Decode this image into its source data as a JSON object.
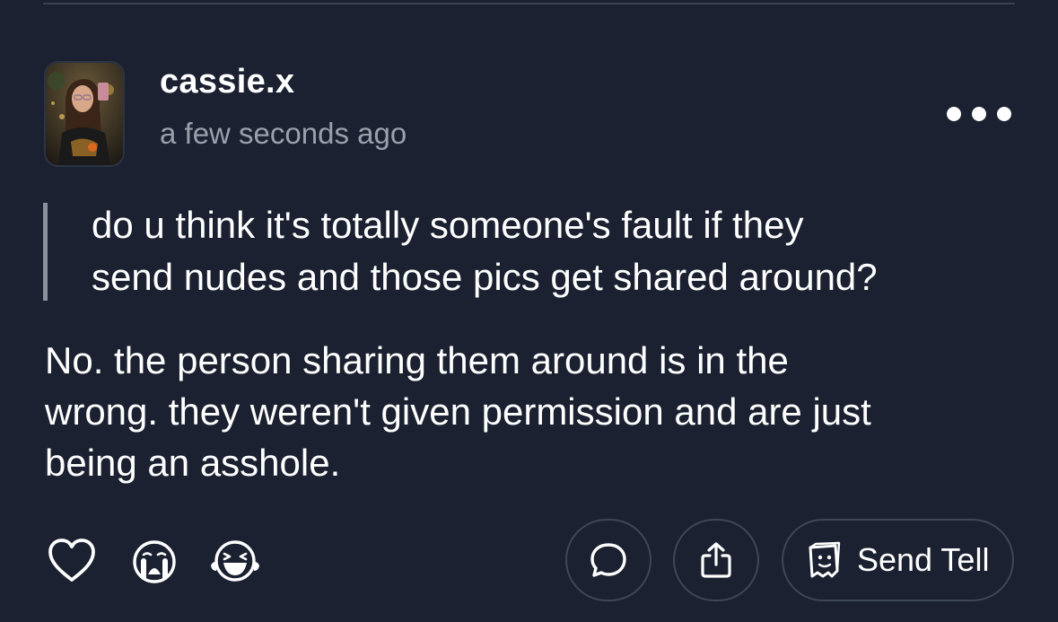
{
  "post": {
    "username": "cassie.x",
    "timestamp": "a few seconds ago",
    "question_line1": "do u think it's totally someone's fault if they",
    "question_line2": "send nudes and those pics get shared around?",
    "answer_line1": "No. the person sharing them around is in the",
    "answer_line2": "wrong. they weren't given permission and are just",
    "answer_line3": "being an asshole."
  },
  "actions": {
    "like_icon": "heart-icon",
    "cry_reaction_icon": "crying-face-icon",
    "laugh_reaction_icon": "laughing-face-icon",
    "comment_icon": "speech-bubble-icon",
    "share_icon": "share-icon",
    "send_tell_icon": "anonymous-message-icon",
    "send_tell_label": "Send Tell"
  },
  "colors": {
    "background": "#1b2130",
    "text": "#ffffff",
    "muted_text": "#9aa0aa",
    "quote_bar": "#8b909a",
    "button_border": "#3f4656"
  }
}
